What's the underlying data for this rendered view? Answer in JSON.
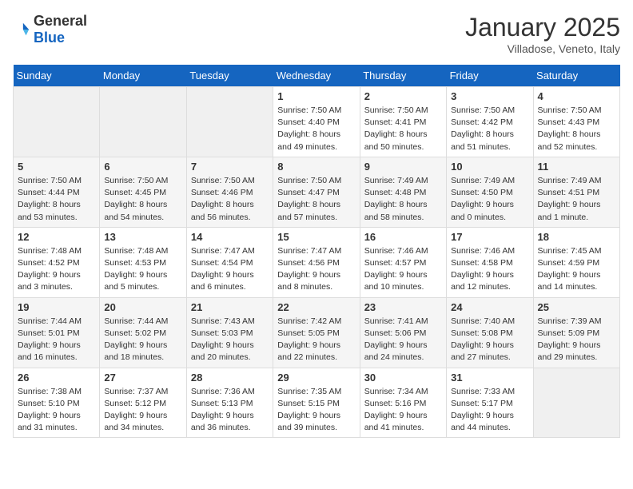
{
  "logo": {
    "general": "General",
    "blue": "Blue"
  },
  "header": {
    "month": "January 2025",
    "location": "Villadose, Veneto, Italy"
  },
  "days_of_week": [
    "Sunday",
    "Monday",
    "Tuesday",
    "Wednesday",
    "Thursday",
    "Friday",
    "Saturday"
  ],
  "weeks": [
    [
      {
        "day": "",
        "empty": true
      },
      {
        "day": "",
        "empty": true
      },
      {
        "day": "",
        "empty": true
      },
      {
        "day": "1",
        "sunrise": "7:50 AM",
        "sunset": "4:40 PM",
        "daylight": "8 hours and 49 minutes."
      },
      {
        "day": "2",
        "sunrise": "7:50 AM",
        "sunset": "4:41 PM",
        "daylight": "8 hours and 50 minutes."
      },
      {
        "day": "3",
        "sunrise": "7:50 AM",
        "sunset": "4:42 PM",
        "daylight": "8 hours and 51 minutes."
      },
      {
        "day": "4",
        "sunrise": "7:50 AM",
        "sunset": "4:43 PM",
        "daylight": "8 hours and 52 minutes."
      }
    ],
    [
      {
        "day": "5",
        "sunrise": "7:50 AM",
        "sunset": "4:44 PM",
        "daylight": "8 hours and 53 minutes."
      },
      {
        "day": "6",
        "sunrise": "7:50 AM",
        "sunset": "4:45 PM",
        "daylight": "8 hours and 54 minutes."
      },
      {
        "day": "7",
        "sunrise": "7:50 AM",
        "sunset": "4:46 PM",
        "daylight": "8 hours and 56 minutes."
      },
      {
        "day": "8",
        "sunrise": "7:50 AM",
        "sunset": "4:47 PM",
        "daylight": "8 hours and 57 minutes."
      },
      {
        "day": "9",
        "sunrise": "7:49 AM",
        "sunset": "4:48 PM",
        "daylight": "8 hours and 58 minutes."
      },
      {
        "day": "10",
        "sunrise": "7:49 AM",
        "sunset": "4:50 PM",
        "daylight": "9 hours and 0 minutes."
      },
      {
        "day": "11",
        "sunrise": "7:49 AM",
        "sunset": "4:51 PM",
        "daylight": "9 hours and 1 minute."
      }
    ],
    [
      {
        "day": "12",
        "sunrise": "7:48 AM",
        "sunset": "4:52 PM",
        "daylight": "9 hours and 3 minutes."
      },
      {
        "day": "13",
        "sunrise": "7:48 AM",
        "sunset": "4:53 PM",
        "daylight": "9 hours and 5 minutes."
      },
      {
        "day": "14",
        "sunrise": "7:47 AM",
        "sunset": "4:54 PM",
        "daylight": "9 hours and 6 minutes."
      },
      {
        "day": "15",
        "sunrise": "7:47 AM",
        "sunset": "4:56 PM",
        "daylight": "9 hours and 8 minutes."
      },
      {
        "day": "16",
        "sunrise": "7:46 AM",
        "sunset": "4:57 PM",
        "daylight": "9 hours and 10 minutes."
      },
      {
        "day": "17",
        "sunrise": "7:46 AM",
        "sunset": "4:58 PM",
        "daylight": "9 hours and 12 minutes."
      },
      {
        "day": "18",
        "sunrise": "7:45 AM",
        "sunset": "4:59 PM",
        "daylight": "9 hours and 14 minutes."
      }
    ],
    [
      {
        "day": "19",
        "sunrise": "7:44 AM",
        "sunset": "5:01 PM",
        "daylight": "9 hours and 16 minutes."
      },
      {
        "day": "20",
        "sunrise": "7:44 AM",
        "sunset": "5:02 PM",
        "daylight": "9 hours and 18 minutes."
      },
      {
        "day": "21",
        "sunrise": "7:43 AM",
        "sunset": "5:03 PM",
        "daylight": "9 hours and 20 minutes."
      },
      {
        "day": "22",
        "sunrise": "7:42 AM",
        "sunset": "5:05 PM",
        "daylight": "9 hours and 22 minutes."
      },
      {
        "day": "23",
        "sunrise": "7:41 AM",
        "sunset": "5:06 PM",
        "daylight": "9 hours and 24 minutes."
      },
      {
        "day": "24",
        "sunrise": "7:40 AM",
        "sunset": "5:08 PM",
        "daylight": "9 hours and 27 minutes."
      },
      {
        "day": "25",
        "sunrise": "7:39 AM",
        "sunset": "5:09 PM",
        "daylight": "9 hours and 29 minutes."
      }
    ],
    [
      {
        "day": "26",
        "sunrise": "7:38 AM",
        "sunset": "5:10 PM",
        "daylight": "9 hours and 31 minutes."
      },
      {
        "day": "27",
        "sunrise": "7:37 AM",
        "sunset": "5:12 PM",
        "daylight": "9 hours and 34 minutes."
      },
      {
        "day": "28",
        "sunrise": "7:36 AM",
        "sunset": "5:13 PM",
        "daylight": "9 hours and 36 minutes."
      },
      {
        "day": "29",
        "sunrise": "7:35 AM",
        "sunset": "5:15 PM",
        "daylight": "9 hours and 39 minutes."
      },
      {
        "day": "30",
        "sunrise": "7:34 AM",
        "sunset": "5:16 PM",
        "daylight": "9 hours and 41 minutes."
      },
      {
        "day": "31",
        "sunrise": "7:33 AM",
        "sunset": "5:17 PM",
        "daylight": "9 hours and 44 minutes."
      },
      {
        "day": "",
        "empty": true
      }
    ]
  ],
  "labels": {
    "sunrise": "Sunrise:",
    "sunset": "Sunset:",
    "daylight": "Daylight:"
  }
}
